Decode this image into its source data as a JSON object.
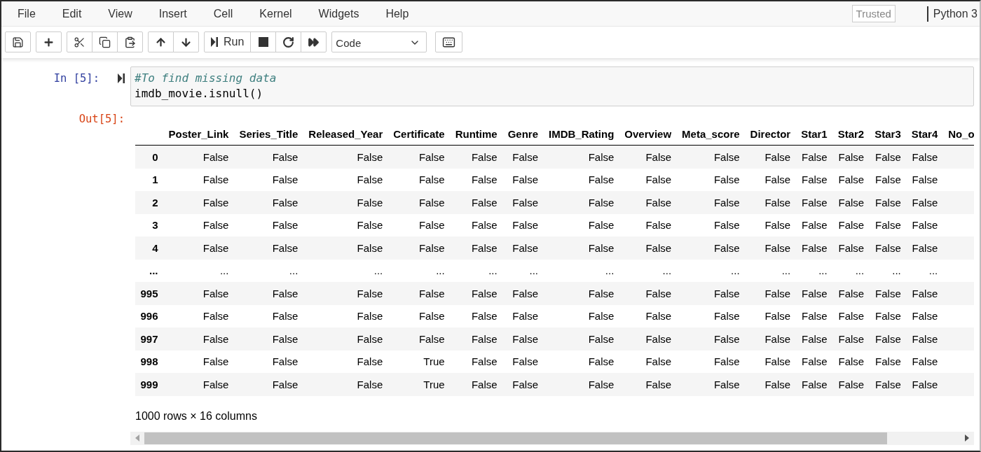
{
  "menubar": {
    "items": [
      "File",
      "Edit",
      "View",
      "Insert",
      "Cell",
      "Kernel",
      "Widgets",
      "Help"
    ],
    "trusted_badge": "Trusted",
    "kernel_name": "Python 3"
  },
  "toolbar": {
    "run_label": "Run",
    "cell_type": "Code"
  },
  "cell": {
    "input_prompt": "In [5]:",
    "code_lines": [
      {
        "kind": "comment",
        "text": "#To find missing data"
      },
      {
        "kind": "code",
        "text": "imdb_movie.isnull()"
      }
    ],
    "output_prompt": "Out[5]:",
    "table": {
      "columns": [
        "Poster_Link",
        "Series_Title",
        "Released_Year",
        "Certificate",
        "Runtime",
        "Genre",
        "IMDB_Rating",
        "Overview",
        "Meta_score",
        "Director",
        "Star1",
        "Star2",
        "Star3",
        "Star4",
        "No_o"
      ],
      "rows": [
        {
          "index": "0",
          "values": [
            "False",
            "False",
            "False",
            "False",
            "False",
            "False",
            "False",
            "False",
            "False",
            "False",
            "False",
            "False",
            "False",
            "False"
          ]
        },
        {
          "index": "1",
          "values": [
            "False",
            "False",
            "False",
            "False",
            "False",
            "False",
            "False",
            "False",
            "False",
            "False",
            "False",
            "False",
            "False",
            "False"
          ]
        },
        {
          "index": "2",
          "values": [
            "False",
            "False",
            "False",
            "False",
            "False",
            "False",
            "False",
            "False",
            "False",
            "False",
            "False",
            "False",
            "False",
            "False"
          ]
        },
        {
          "index": "3",
          "values": [
            "False",
            "False",
            "False",
            "False",
            "False",
            "False",
            "False",
            "False",
            "False",
            "False",
            "False",
            "False",
            "False",
            "False"
          ]
        },
        {
          "index": "4",
          "values": [
            "False",
            "False",
            "False",
            "False",
            "False",
            "False",
            "False",
            "False",
            "False",
            "False",
            "False",
            "False",
            "False",
            "False"
          ]
        },
        {
          "index": "...",
          "values": [
            "...",
            "...",
            "...",
            "...",
            "...",
            "...",
            "...",
            "...",
            "...",
            "...",
            "...",
            "...",
            "...",
            "..."
          ]
        },
        {
          "index": "995",
          "values": [
            "False",
            "False",
            "False",
            "False",
            "False",
            "False",
            "False",
            "False",
            "False",
            "False",
            "False",
            "False",
            "False",
            "False"
          ]
        },
        {
          "index": "996",
          "values": [
            "False",
            "False",
            "False",
            "False",
            "False",
            "False",
            "False",
            "False",
            "False",
            "False",
            "False",
            "False",
            "False",
            "False"
          ]
        },
        {
          "index": "997",
          "values": [
            "False",
            "False",
            "False",
            "False",
            "False",
            "False",
            "False",
            "False",
            "False",
            "False",
            "False",
            "False",
            "False",
            "False"
          ]
        },
        {
          "index": "998",
          "values": [
            "False",
            "False",
            "False",
            "True",
            "False",
            "False",
            "False",
            "False",
            "False",
            "False",
            "False",
            "False",
            "False",
            "False"
          ]
        },
        {
          "index": "999",
          "values": [
            "False",
            "False",
            "False",
            "True",
            "False",
            "False",
            "False",
            "False",
            "False",
            "False",
            "False",
            "False",
            "False",
            "False"
          ]
        }
      ]
    },
    "shape_note": "1000 rows × 16 columns"
  }
}
